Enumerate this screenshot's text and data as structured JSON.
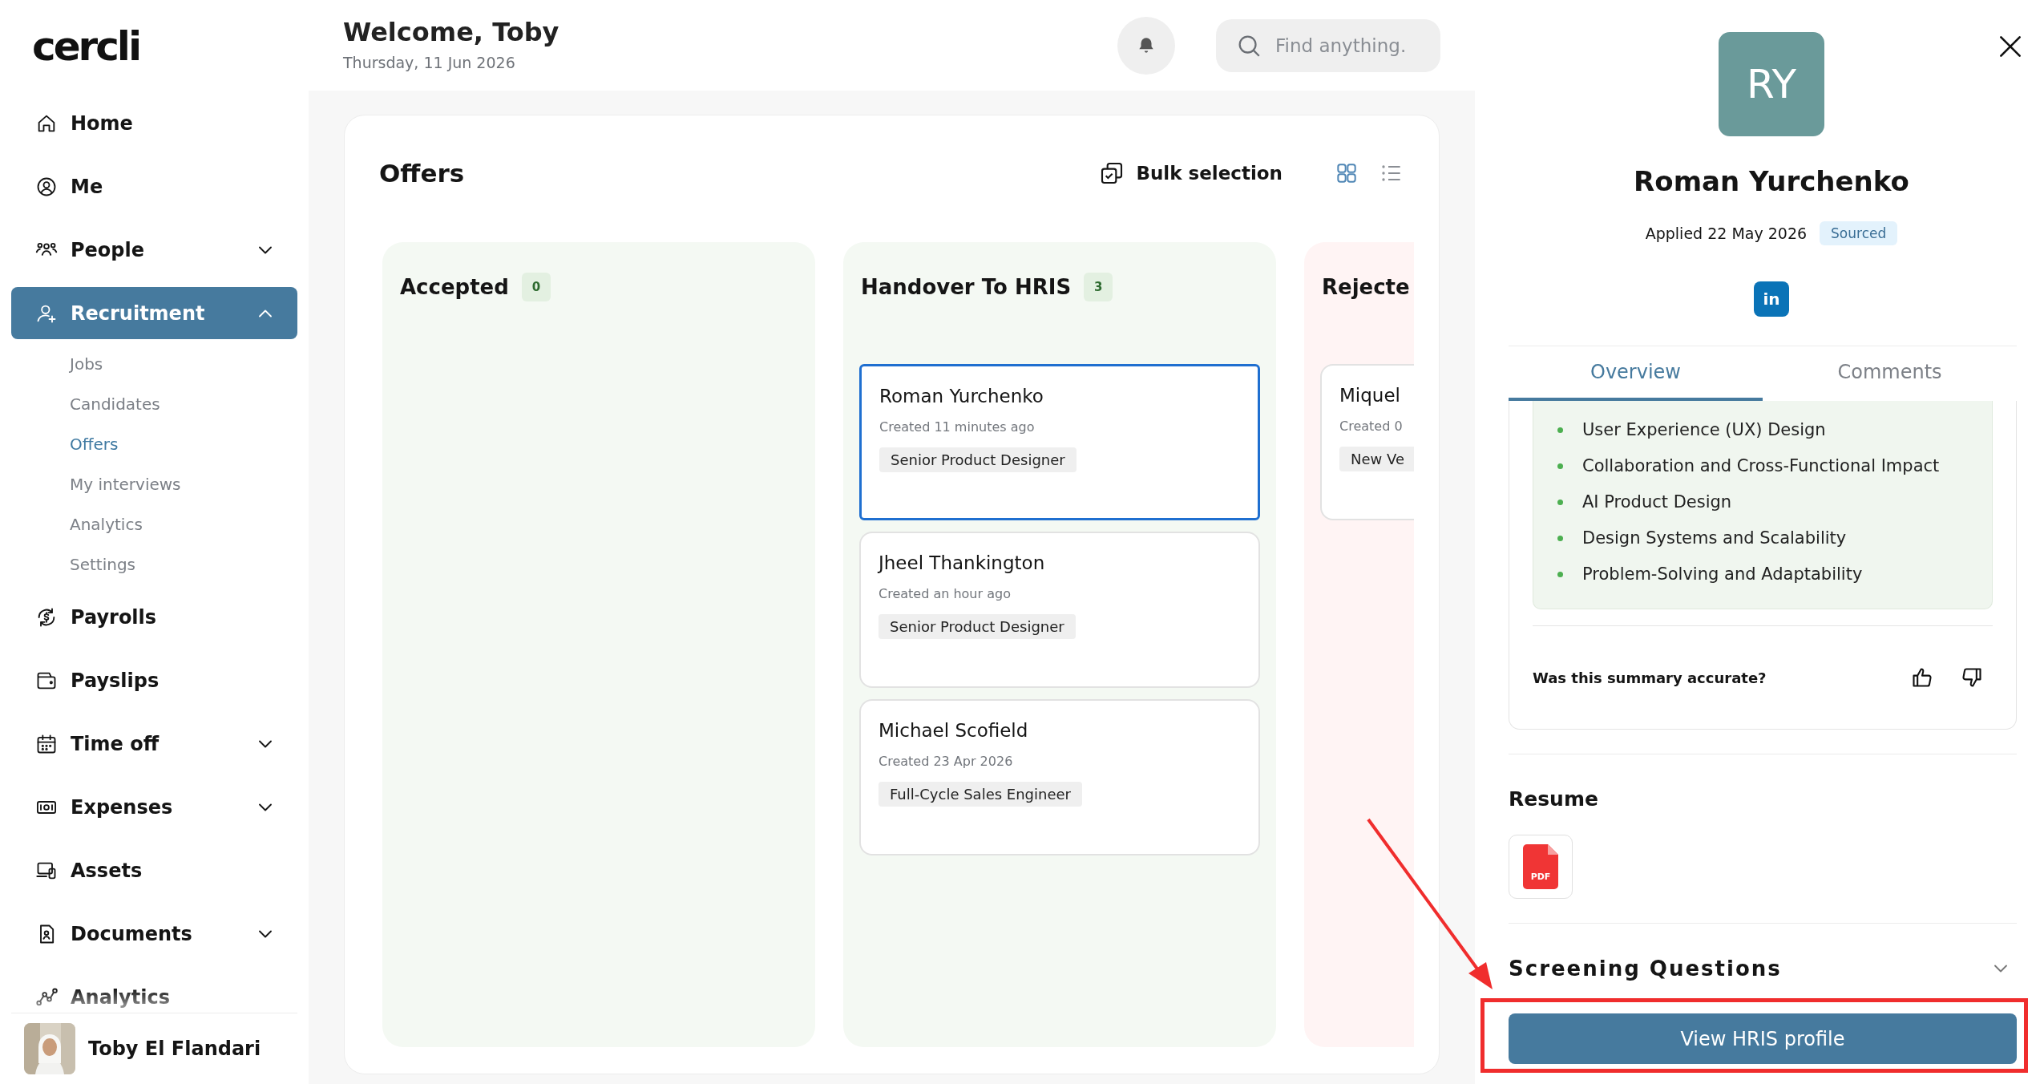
{
  "sidebar": {
    "logo": "cercli",
    "items": [
      {
        "label": "Home",
        "kind": "link",
        "selected": false
      },
      {
        "label": "Me",
        "kind": "link",
        "selected": false
      },
      {
        "label": "People",
        "kind": "group",
        "selected": false,
        "expanded": false
      },
      {
        "label": "Recruitment",
        "kind": "group",
        "selected": true,
        "expanded": true,
        "children": [
          {
            "label": "Jobs",
            "selected": false
          },
          {
            "label": "Candidates",
            "selected": false
          },
          {
            "label": "Offers",
            "selected": true
          },
          {
            "label": "My interviews",
            "selected": false
          },
          {
            "label": "Analytics",
            "selected": false
          },
          {
            "label": "Settings",
            "selected": false
          }
        ]
      },
      {
        "label": "Payrolls",
        "kind": "link",
        "selected": false
      },
      {
        "label": "Payslips",
        "kind": "link",
        "selected": false
      },
      {
        "label": "Time off",
        "kind": "group",
        "selected": false,
        "expanded": false
      },
      {
        "label": "Expenses",
        "kind": "group",
        "selected": false,
        "expanded": false
      },
      {
        "label": "Assets",
        "kind": "link",
        "selected": false
      },
      {
        "label": "Documents",
        "kind": "group",
        "selected": false,
        "expanded": false
      },
      {
        "label": "Analytics",
        "kind": "link",
        "selected": false
      }
    ],
    "user": {
      "name": "Toby El Flandari"
    }
  },
  "header": {
    "title": "Welcome, Toby",
    "date": "Thursday, 11 Jun 2026",
    "search": {
      "placeholder": "Find anything."
    }
  },
  "board": {
    "title": "Offers",
    "bulk_action": "Bulk selection",
    "view_modes": [
      {
        "kind": "grid",
        "selected": true
      },
      {
        "kind": "list",
        "selected": false
      }
    ],
    "columns": [
      {
        "title": "Accepted",
        "count": "0",
        "color": "#f4f9f3"
      },
      {
        "title": "Handover To HRIS",
        "count": "3",
        "color": "#f4f9f3",
        "cards": [
          {
            "name": "Roman Yurchenko",
            "created": "Created 11 minutes ago",
            "role": "Senior Product Designer",
            "selected": true
          },
          {
            "name": "Jheel Thankington",
            "created": "Created an hour ago",
            "role": "Senior Product Designer",
            "selected": false
          },
          {
            "name": "Michael Scofield",
            "created": "Created 23 Apr 2026",
            "role": "Full-Cycle Sales Engineer",
            "selected": false
          }
        ]
      },
      {
        "title": "Rejecte",
        "color": "#fff4f4",
        "cards": [
          {
            "name": "Miquel",
            "created": "Created 0",
            "role": "New Ve",
            "selected": false
          }
        ]
      }
    ]
  },
  "panel": {
    "initials": "RY",
    "name": "Roman Yurchenko",
    "applied": "Applied 22 May 2026",
    "status": "Sourced",
    "linkedin": "in",
    "tabs": [
      {
        "label": "Overview",
        "selected": true
      },
      {
        "label": "Comments",
        "selected": false
      }
    ],
    "summary": [
      "User Experience (UX) Design",
      "Collaboration and Cross-Functional Impact",
      "AI Product Design",
      "Design Systems and Scalability",
      "Problem-Solving and Adaptability"
    ],
    "feedback_question": "Was this summary accurate?",
    "resume": {
      "title": "Resume",
      "file_label": "PDF"
    },
    "screening": {
      "title": "Screening Questions",
      "expanded": false
    },
    "button": "View HRIS profile"
  },
  "annotations": {
    "arrow": true,
    "highlight_frame": true
  }
}
